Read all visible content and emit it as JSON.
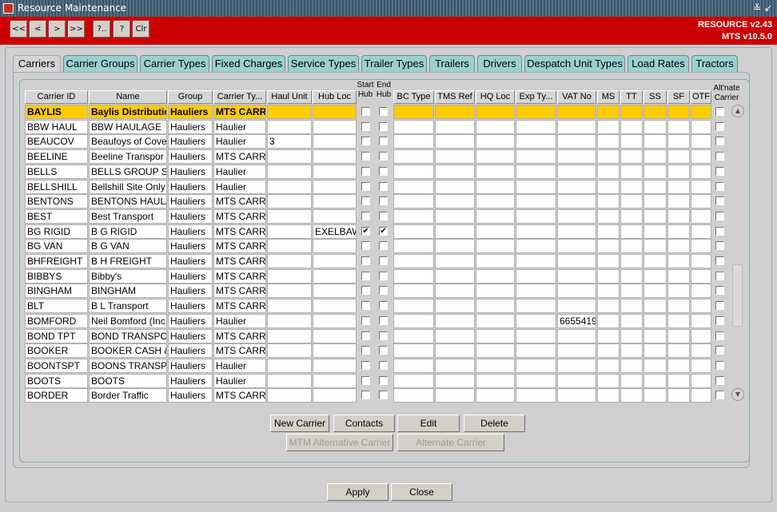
{
  "window": {
    "title": "Resource Maintenance",
    "controls": [
      "≚",
      "↙"
    ]
  },
  "toolbar": {
    "buttons": [
      "<<",
      "<",
      ">",
      ">>",
      "?..",
      "?",
      "Clr"
    ],
    "version_line1": "RESOURCE v2.43",
    "version_line2": "MTS v10.5.0",
    "background_color": "#cc0000"
  },
  "tabs": [
    "Carriers",
    "Carrier Groups",
    "Carrier Types",
    "Fixed Charges",
    "Service Types",
    "Trailer Types",
    "Trailers",
    "Drivers",
    "Despatch Unit Types",
    "Load Rates",
    "Tractors"
  ],
  "active_tab": "Carriers",
  "grid": {
    "columns": {
      "carrier_id": "Carrier ID",
      "name": "Name",
      "group": "Group",
      "carrier_type": "Carrier Ty...",
      "haul_unit": "Haul Unit",
      "hub_loc": "Hub Loc",
      "start_hub": "Start Hub",
      "end_hub": "End Hub",
      "bc_type": "BC Type",
      "tms_ref": "TMS Ref",
      "hq_loc": "HQ Loc",
      "exp_type": "Exp Ty...",
      "vat_no": "VAT No",
      "ms": "MS",
      "tt": "TT",
      "ss": "SS",
      "sf": "SF",
      "otf": "OTF",
      "altnate_carrier": "Alt'nate Carrier"
    },
    "start_hub_line1": "Start",
    "start_hub_line2": "Hub",
    "end_hub_line1": "End",
    "end_hub_line2": "Hub",
    "alt_line1": "Alt'nate",
    "alt_line2": "Carrier",
    "selected_color": "#ffcc00",
    "rows": [
      {
        "id": "BAYLIS",
        "name": "Baylis Distributio",
        "group": "Hauliers",
        "type": "MTS CARRI",
        "haul": "",
        "hub": "",
        "start": false,
        "end": false,
        "vat": "",
        "selected": true
      },
      {
        "id": "BBW HAUL",
        "name": "BBW HAULAGE",
        "group": "Hauliers",
        "type": "Haulier",
        "haul": "",
        "hub": "",
        "start": false,
        "end": false,
        "vat": ""
      },
      {
        "id": "BEAUCOV",
        "name": "Beaufoys of Cove",
        "group": "Hauliers",
        "type": "Haulier",
        "haul": "3",
        "hub": "",
        "start": false,
        "end": false,
        "vat": ""
      },
      {
        "id": "BEELINE",
        "name": "Beeline Transpor",
        "group": "Hauliers",
        "type": "MTS CARR",
        "haul": "",
        "hub": "",
        "start": false,
        "end": false,
        "vat": ""
      },
      {
        "id": "BELLS",
        "name": "BELLS GROUP S",
        "group": "Hauliers",
        "type": "Haulier",
        "haul": "",
        "hub": "",
        "start": false,
        "end": false,
        "vat": ""
      },
      {
        "id": "BELLSHILL",
        "name": "Bellshill Site Only",
        "group": "Hauliers",
        "type": "Haulier",
        "haul": "",
        "hub": "",
        "start": false,
        "end": false,
        "vat": ""
      },
      {
        "id": "BENTONS",
        "name": "BENTONS HAUL/",
        "group": "Hauliers",
        "type": "MTS CARR",
        "haul": "",
        "hub": "",
        "start": false,
        "end": false,
        "vat": ""
      },
      {
        "id": "BEST",
        "name": "Best Transport",
        "group": "Hauliers",
        "type": "MTS CARR",
        "haul": "",
        "hub": "",
        "start": false,
        "end": false,
        "vat": ""
      },
      {
        "id": "BG RIGID",
        "name": "B G RIGID",
        "group": "Hauliers",
        "type": "MTS CARR",
        "haul": "",
        "hub": "EXELBAW",
        "start": true,
        "end": true,
        "vat": ""
      },
      {
        "id": "BG VAN",
        "name": "B G VAN",
        "group": "Hauliers",
        "type": "MTS CARR",
        "haul": "",
        "hub": "",
        "start": false,
        "end": false,
        "vat": ""
      },
      {
        "id": "BHFREIGHT",
        "name": "B H FREIGHT",
        "group": "Hauliers",
        "type": "MTS CARR",
        "haul": "",
        "hub": "",
        "start": false,
        "end": false,
        "vat": ""
      },
      {
        "id": "BIBBYS",
        "name": "Bibby's",
        "group": "Hauliers",
        "type": "MTS CARR",
        "haul": "",
        "hub": "",
        "start": false,
        "end": false,
        "vat": ""
      },
      {
        "id": "BINGHAM",
        "name": "BINGHAM",
        "group": "Hauliers",
        "type": "MTS CARR",
        "haul": "",
        "hub": "",
        "start": false,
        "end": false,
        "vat": ""
      },
      {
        "id": "BLT",
        "name": "B L Transport",
        "group": "Hauliers",
        "type": "MTS CARR",
        "haul": "",
        "hub": "",
        "start": false,
        "end": false,
        "vat": ""
      },
      {
        "id": "BOMFORD",
        "name": "Neil Bomford (Inc",
        "group": "Hauliers",
        "type": "Haulier",
        "haul": "",
        "hub": "",
        "start": false,
        "end": false,
        "vat": "6655419"
      },
      {
        "id": "BOND TPT",
        "name": "BOND TRANSPO",
        "group": "Hauliers",
        "type": "MTS CARR",
        "haul": "",
        "hub": "",
        "start": false,
        "end": false,
        "vat": ""
      },
      {
        "id": "BOOKER",
        "name": "BOOKER CASH &",
        "group": "Hauliers",
        "type": "MTS CARR",
        "haul": "",
        "hub": "",
        "start": false,
        "end": false,
        "vat": ""
      },
      {
        "id": "BOONTSPT",
        "name": "BOONS TRANSP",
        "group": "Hauliers",
        "type": "Haulier",
        "haul": "",
        "hub": "",
        "start": false,
        "end": false,
        "vat": ""
      },
      {
        "id": "BOOTS",
        "name": "BOOTS",
        "group": "Hauliers",
        "type": "Haulier",
        "haul": "",
        "hub": "",
        "start": false,
        "end": false,
        "vat": ""
      },
      {
        "id": "BORDER",
        "name": "Border Traffic",
        "group": "Hauliers",
        "type": "MTS CARR",
        "haul": "",
        "hub": "",
        "start": false,
        "end": false,
        "vat": ""
      }
    ]
  },
  "actions": {
    "new_carrier": "New Carrier",
    "contacts": "Contacts",
    "edit": "Edit",
    "delete": "Delete",
    "mtm_alt": "MTM Alternative Carrier",
    "alt_carrier": "Alternate Carrier"
  },
  "footer": {
    "apply": "Apply",
    "close": "Close"
  },
  "scroll": {
    "up_icon": "▲",
    "down_icon": "▼"
  }
}
